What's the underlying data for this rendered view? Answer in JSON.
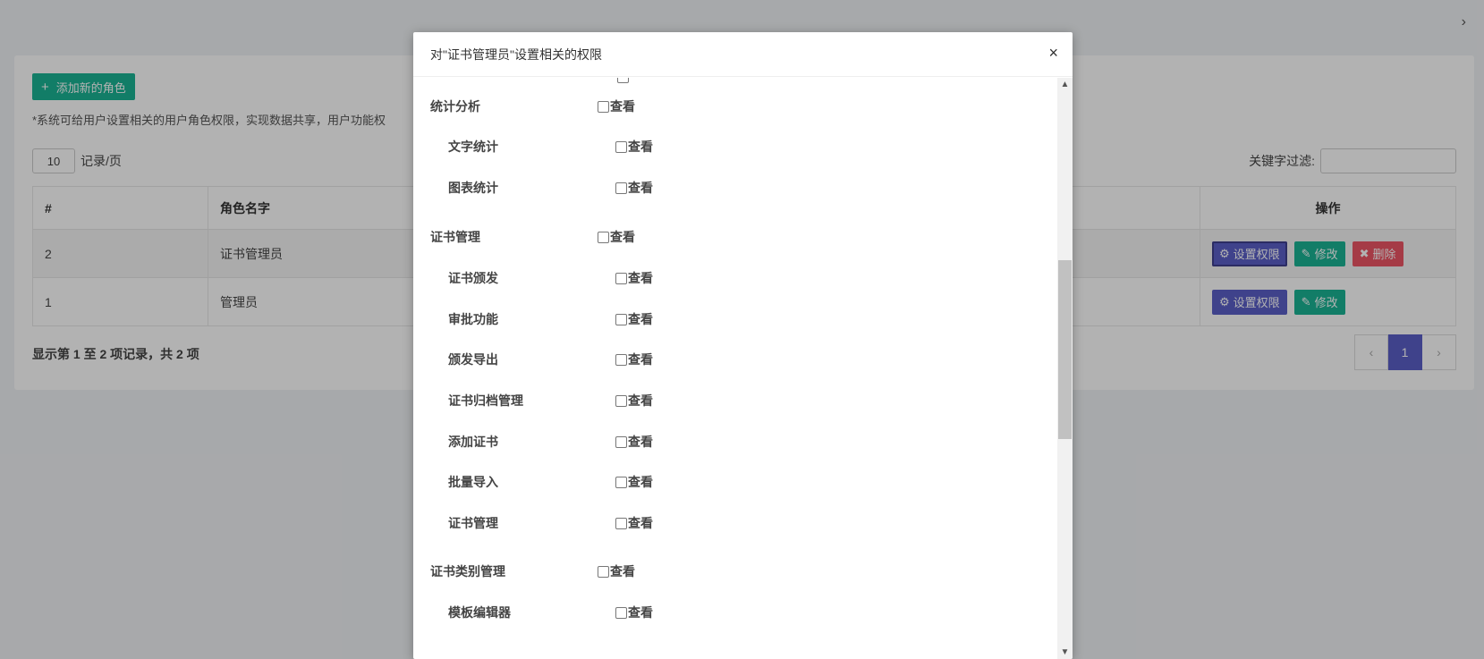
{
  "page": {
    "add_button_label": "添加新的角色",
    "note": "*系统可给用户设置相关的用户角色权限，实现数据共享，用户功能权",
    "page_size": "10",
    "page_size_suffix": "记录/页",
    "filter_label": "关键字过滤:",
    "table": {
      "headers": [
        "#",
        "角色名字",
        "操作"
      ],
      "rows": [
        {
          "id": "2",
          "name": "证书管理员"
        },
        {
          "id": "1",
          "name": "管理员"
        }
      ]
    },
    "buttons": {
      "perm": "设置权限",
      "edit": "修改",
      "del": "删除"
    },
    "summary": "显示第 1 至 2 项记录，共 2 项",
    "pagination": {
      "prev": "‹",
      "current": "1",
      "next": "›"
    }
  },
  "modal": {
    "title": "对\"证书管理员\"设置相关的权限",
    "close": "×",
    "view_label": "查看",
    "permissions": [
      {
        "label": "统计分析",
        "level": 0
      },
      {
        "label": "文字统计",
        "level": 1
      },
      {
        "label": "图表统计",
        "level": 1
      },
      {
        "label": "证书管理",
        "level": 0
      },
      {
        "label": "证书颁发",
        "level": 1
      },
      {
        "label": "审批功能",
        "level": 1
      },
      {
        "label": "颁发导出",
        "level": 1
      },
      {
        "label": "证书归档管理",
        "level": 1
      },
      {
        "label": "添加证书",
        "level": 1
      },
      {
        "label": "批量导入",
        "level": 1
      },
      {
        "label": "证书管理",
        "level": 1
      },
      {
        "label": "证书类别管理",
        "level": 0
      },
      {
        "label": "模板编辑器",
        "level": 1
      }
    ]
  },
  "colors": {
    "primary": "#5b5fc7",
    "success": "#1ab394",
    "danger": "#ed5565"
  }
}
